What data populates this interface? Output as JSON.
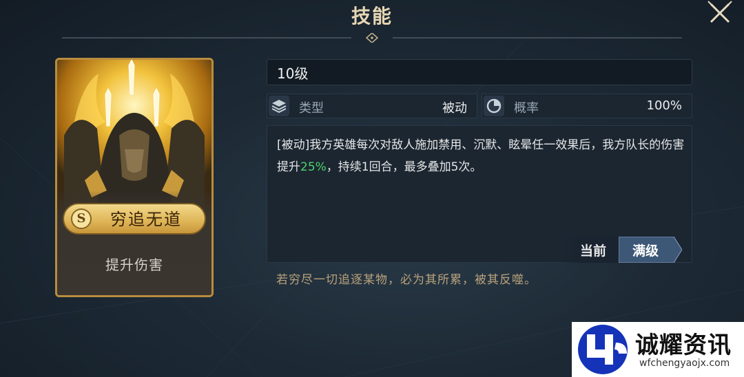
{
  "header": {
    "title": "技能"
  },
  "card": {
    "grade": "S",
    "skill_name": "穷追无道",
    "skill_desc": "提升伤害"
  },
  "panel": {
    "level": "10级",
    "type_label": "类型",
    "type_value": "被动",
    "rate_label": "概率",
    "rate_value": "100%",
    "description": {
      "part1": "[被动]我方英雄每次对敌人施加禁用、沉默、眩晕任一效果后，我方队长的伤害提升",
      "highlight": "25%",
      "part2": "，持续1回合，最多叠加5次。"
    },
    "toggle_current": "当前",
    "toggle_max": "满级",
    "flavor_text": "若穷尽一切追逐某物，必为其所累，被其反噬。"
  },
  "watermark": {
    "name": "诚耀资讯",
    "url": "wfchengyaojx.com"
  },
  "colors": {
    "gold": "#b98d3e",
    "highlight_green": "#4fd36c",
    "active_tab": "#3d5777"
  }
}
